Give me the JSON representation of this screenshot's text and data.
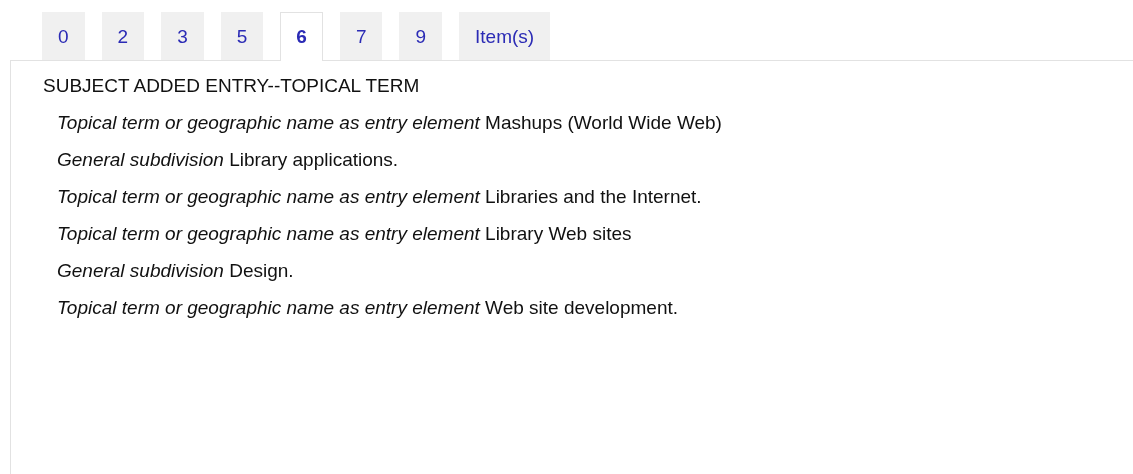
{
  "tabs": [
    {
      "label": "0",
      "selected": false
    },
    {
      "label": "2",
      "selected": false
    },
    {
      "label": "3",
      "selected": false
    },
    {
      "label": "5",
      "selected": false
    },
    {
      "label": "6",
      "selected": true
    },
    {
      "label": "7",
      "selected": false
    },
    {
      "label": "9",
      "selected": false
    },
    {
      "label": "Item(s)",
      "selected": false
    }
  ],
  "panel": {
    "heading": "SUBJECT ADDED ENTRY--TOPICAL TERM",
    "subfields": [
      {
        "label": "Topical term or geographic name as entry element",
        "value": "Mashups (World Wide Web)"
      },
      {
        "label": "General subdivision",
        "value": "Library applications."
      },
      {
        "label": "Topical term or geographic name as entry element",
        "value": "Libraries and the Internet."
      },
      {
        "label": "Topical term or geographic name as entry element",
        "value": "Library Web sites"
      },
      {
        "label": "General subdivision",
        "value": "Design."
      },
      {
        "label": "Topical term or geographic name as entry element",
        "value": "Web site development."
      }
    ]
  }
}
